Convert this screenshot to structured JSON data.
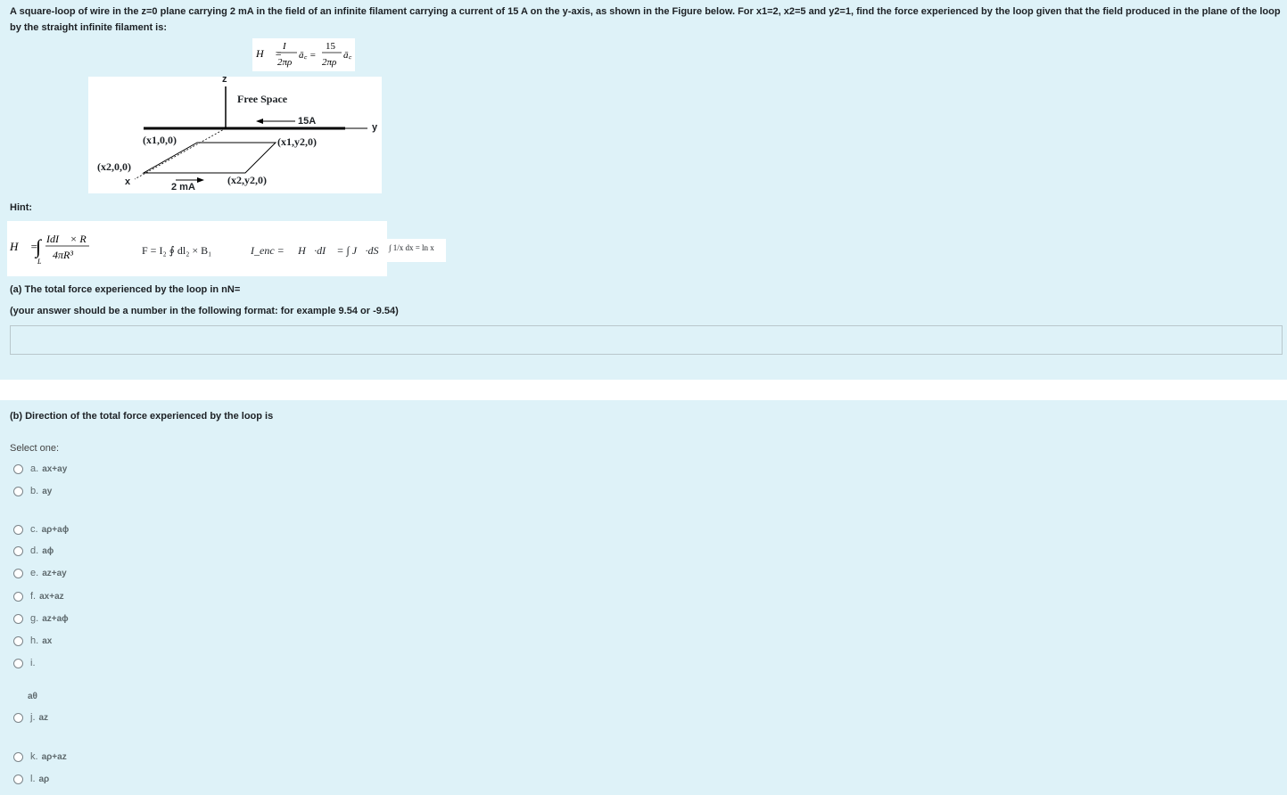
{
  "question_text": "A square-loop of wire in the z=0 plane carrying 2 mA in the field of an infinite filament carrying a current of 15 A on the y-axis, as shown in the Figure below. For x1=2, x2=5 and y2=1, find the force experienced by the loop given that the field produced in the plane of the loop by the straight infinite filament is:",
  "formula_field": {
    "lhs": "H⃗ =",
    "num1": "I",
    "den1": "2πρ",
    "unit1": "ā_z =",
    "num2": "15",
    "den2": "2πρ",
    "unit2": "ā_z"
  },
  "figure": {
    "z_label": "z",
    "free_space": "Free Space",
    "current_15": "15A",
    "y_label": "y",
    "p_x1_0": "(x1,0,0)",
    "p_x1_y2": "(x1,y2,0)",
    "p_x2_0": "(x2,0,0)",
    "x_label": "x",
    "current_2": "2 mA",
    "p_x2_y2": "(x2,y2,0)"
  },
  "hint_label": "Hint:",
  "hints": {
    "biot": "H⃗ = ∫ IdI⃗ × R⃗ / 4πR³",
    "force": "F = I₂ ∮ dl₂ × B₁",
    "ampere": "I_enc = ∮ H⃗·dI⃗ = ∫ J⃗·dS⃗",
    "integral": "∫ 1/x dx = ln x"
  },
  "part_a": {
    "label": "(a) The total force experienced by the loop in nN=",
    "format": "(your answer should be a number in the following format: for example 9.54 or -9.54)",
    "answer_value": ""
  },
  "part_b": {
    "label": "(b) Direction of the total force experienced by the loop is",
    "select_one": "Select one:",
    "options": [
      {
        "letter": "a.",
        "value": "ax+ay"
      },
      {
        "letter": "b.",
        "value": "ay"
      },
      {
        "letter": "c.",
        "value": "aρ+aɸ"
      },
      {
        "letter": "d.",
        "value": "aɸ"
      },
      {
        "letter": "e.",
        "value": "az+ay"
      },
      {
        "letter": "f.",
        "value": "ax+az"
      },
      {
        "letter": "g.",
        "value": "az+aɸ"
      },
      {
        "letter": "h.",
        "value": "ax"
      },
      {
        "letter": "i.",
        "value": "aθ"
      },
      {
        "letter": "j.",
        "value": "az"
      },
      {
        "letter": "k.",
        "value": "aρ+az"
      },
      {
        "letter": "l.",
        "value": "aρ"
      }
    ]
  }
}
